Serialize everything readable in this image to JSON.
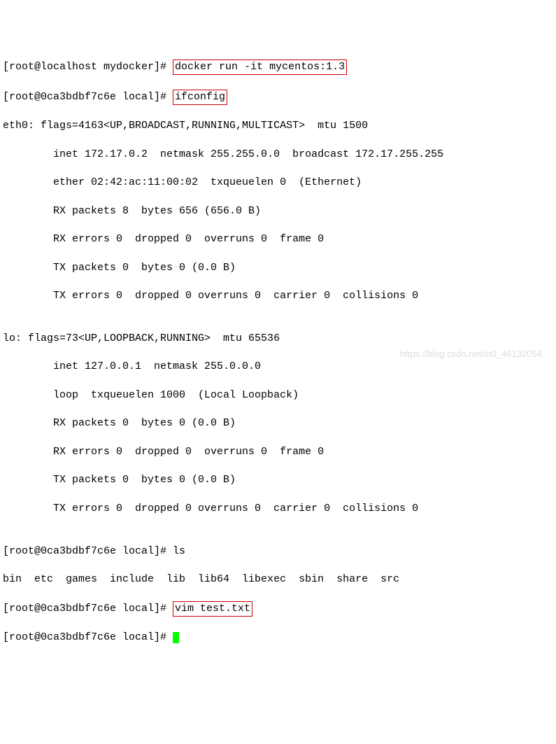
{
  "p1": {
    "prefix": "[root@localhost mydocker]# ",
    "cmd": "docker run -it mycentos:1.3"
  },
  "p2": {
    "prefix": "[root@0ca3bdbf7c6e local]# ",
    "cmd": "ifconfig"
  },
  "eth_header": "eth0: flags=4163<UP,BROADCAST,RUNNING,MULTICAST>  mtu 1500",
  "eth_l1": "        inet 172.17.0.2  netmask 255.255.0.0  broadcast 172.17.255.255",
  "eth_l2": "        ether 02:42:ac:11:00:02  txqueuelen 0  (Ethernet)",
  "eth_l3": "        RX packets 8  bytes 656 (656.0 B)",
  "eth_l4": "        RX errors 0  dropped 0  overruns 0  frame 0",
  "eth_l5": "        TX packets 0  bytes 0 (0.0 B)",
  "eth_l6": "        TX errors 0  dropped 0 overruns 0  carrier 0  collisions 0",
  "blank": "",
  "lo_header": "lo: flags=73<UP,LOOPBACK,RUNNING>  mtu 65536",
  "lo_l1": "        inet 127.0.0.1  netmask 255.0.0.0",
  "lo_l2": "        loop  txqueuelen 1000  (Local Loopback)",
  "lo_l3": "        RX packets 0  bytes 0 (0.0 B)",
  "lo_l4": "        RX errors 0  dropped 0  overruns 0  frame 0",
  "lo_l5": "        TX packets 0  bytes 0 (0.0 B)",
  "lo_l6": "        TX errors 0  dropped 0 overruns 0  carrier 0  collisions 0",
  "p3": {
    "prefix": "[root@0ca3bdbf7c6e local]# ",
    "cmd": "ls"
  },
  "ls_out": "bin  etc  games  include  lib  lib64  libexec  sbin  share  src",
  "p4": {
    "prefix": "[root@0ca3bdbf7c6e local]# ",
    "cmd": "vim test.txt"
  },
  "p5": {
    "prefix": "[root@0ca3bdbf7c6e local]# "
  },
  "watermark": "https://blog.csdn.net/m0_46132054"
}
